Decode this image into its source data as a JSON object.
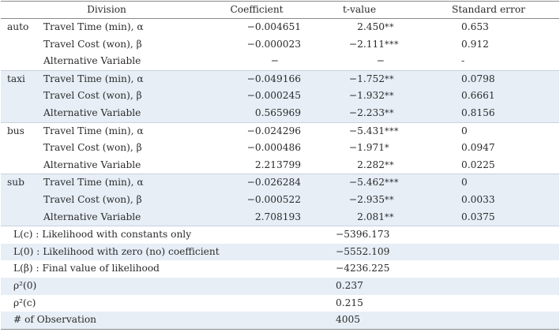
{
  "headers": {
    "division": "Division",
    "coefficient": "Coefficient",
    "tvalue": "t-value",
    "stderr": "Standard error"
  },
  "groups": [
    {
      "name": "auto",
      "shade": false,
      "rows": [
        {
          "variable": "Travel Time (min), α",
          "coef": "-0.004651",
          "t": "2.450",
          "stars": "**",
          "se": "0.653"
        },
        {
          "variable": "Travel Cost (won), β",
          "coef": "-0.000023",
          "t": "-2.111",
          "stars": "***",
          "se": "0.912"
        },
        {
          "variable": "Alternative Variable",
          "coef": "-",
          "t": "-",
          "stars": "",
          "se": "-"
        }
      ]
    },
    {
      "name": "taxi",
      "shade": true,
      "rows": [
        {
          "variable": "Travel Time (min), α",
          "coef": "-0.049166",
          "t": "-1.752",
          "stars": "**",
          "se": "0.0798"
        },
        {
          "variable": "Travel Cost (won), β",
          "coef": "-0.000245",
          "t": "-1.932",
          "stars": "**",
          "se": "0.6661"
        },
        {
          "variable": "Alternative Variable",
          "coef": "0.565969",
          "t": "-2.233",
          "stars": "**",
          "se": "0.8156"
        }
      ]
    },
    {
      "name": "bus",
      "shade": false,
      "rows": [
        {
          "variable": "Travel Time (min), α",
          "coef": "-0.024296",
          "t": "-5.431",
          "stars": "***",
          "se": "0"
        },
        {
          "variable": "Travel Cost (won), β",
          "coef": "-0.000486",
          "t": "-1.971",
          "stars": "*",
          "se": "0.0947"
        },
        {
          "variable": "Alternative Variable",
          "coef": "2.213799",
          "t": "2.282",
          "stars": "**",
          "se": "0.0225"
        }
      ]
    },
    {
      "name": "sub",
      "shade": true,
      "rows": [
        {
          "variable": "Travel Time (min), α",
          "coef": "-0.026284",
          "t": "-5.462",
          "stars": "***",
          "se": "0"
        },
        {
          "variable": "Travel Cost (won), β",
          "coef": "-0.000522",
          "t": "-2.935",
          "stars": "**",
          "se": "0.0033"
        },
        {
          "variable": "Alternative Variable",
          "coef": "2.708193",
          "t": "2.081",
          "stars": "**",
          "se": "0.0375"
        }
      ]
    }
  ],
  "summary": [
    {
      "label": "L(c) : Likelihood with constants only",
      "value": "-5396.173",
      "shade": false
    },
    {
      "label": "L(0) : Likelihood with zero (no) coefficient",
      "value": "-5552.109",
      "shade": true
    },
    {
      "label": "L(β) : Final value of likelihood",
      "value": "-4236.225",
      "shade": false
    },
    {
      "label": "ρ²(0)",
      "value": "0.237",
      "shade": true
    },
    {
      "label": "ρ²(c)",
      "value": "0.215",
      "shade": false
    },
    {
      "label": "# of Observation",
      "value": "4005",
      "shade": true
    }
  ]
}
